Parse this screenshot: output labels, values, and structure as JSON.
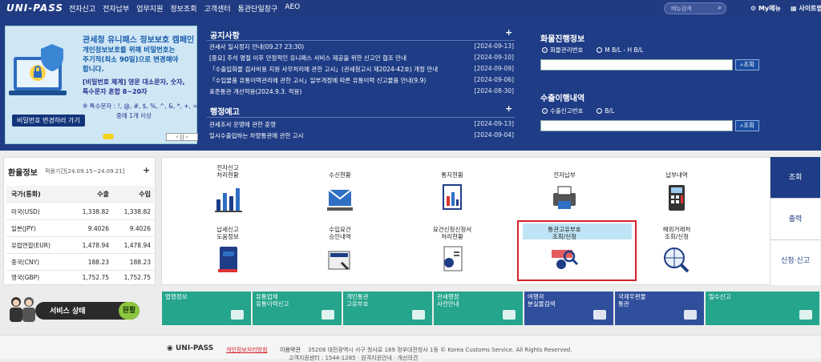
{
  "header": {
    "logo": "UNI-PASS",
    "nav": [
      "전자신고",
      "전자납부",
      "업무지원",
      "정보조회",
      "고객센터",
      "통관단일창구",
      "AEO"
    ],
    "search_placeholder": "메뉴검색",
    "mymenu": "My메뉴",
    "sitemap": "사이트맵"
  },
  "banner": {
    "title": "관세청 유니패스 정보보호 캠페인",
    "lines": [
      "개인정보보호를 위해 비밀번호는",
      "주기적(최소 90일)으로 변경해야",
      "합니다."
    ],
    "rules": [
      "[비밀번호 체계] 영문 대소문자, 숫자,",
      "특수문자 혼합 8~20자"
    ],
    "special": [
      "※ 특수문자 : !, @, #, $, %, ^, &, *, +, =, _",
      "중에 1개 이상"
    ],
    "button": "비밀번호 변경하러 가기",
    "controls": "‹  ||  ›"
  },
  "notice": {
    "title": "공지사항",
    "items": [
      {
        "text": "관세사 일시정지 안내(09.27 23:30)",
        "date": "[2024-09-13]"
      },
      {
        "text": "[중요] 추석 명절 이후 안정적인 유니패스 서비스 제공을 위한 신고인 협조 안내",
        "date": "[2024-09-10]"
      },
      {
        "text": "「수출입화물 검사비용 지원 사무처리에 관한 고시」(관세청고시 제2024-42호) 개정 안내",
        "date": "[2024-09-09]"
      },
      {
        "text": "「수입물품 유통이력관리에 관한 고시」일부개정에 따른 유통이력 신고물품 안내(9.9)",
        "date": "[2024-09-06]"
      },
      {
        "text": "표준통관 개선적용(2024.9.3. 적용)",
        "date": "[2024-08-30]"
      }
    ]
  },
  "admin_notice": {
    "title": "행정예고",
    "items": [
      {
        "text": "관세조사 운영에 관한 훈령",
        "date": "[2024-09-13]"
      },
      {
        "text": "일시수출입하는 차량통관에 관한 고시",
        "date": "[2024-09-04]"
      }
    ]
  },
  "cargo": {
    "title": "화물진행정보",
    "options": [
      "화물관리번호",
      "M B/L - H B/L"
    ],
    "button": "조회"
  },
  "export": {
    "title": "수출이행내역",
    "options": [
      "수출신고번호",
      "B/L"
    ],
    "button": "조회"
  },
  "fx": {
    "title": "환율정보",
    "period": "적용기간[24.09.15~24.09.21]",
    "headers": [
      "국가(통화)",
      "수출",
      "수입"
    ],
    "rows": [
      [
        "미국(USD)",
        "1,338.82",
        "1,338.82"
      ],
      [
        "일본(JPY)",
        "9.4026",
        "9.4026"
      ],
      [
        "유럽연합(EUR)",
        "1,478.94",
        "1,478.94"
      ],
      [
        "중국(CNY)",
        "188.23",
        "188.23"
      ],
      [
        "영국(GBP)",
        "1,752.75",
        "1,752.75"
      ]
    ]
  },
  "status": {
    "label": "서비스 상태",
    "value": "원활"
  },
  "services": [
    {
      "label": "전자신고\n처리현황",
      "icon": "chart-icon"
    },
    {
      "label": "수신현황",
      "icon": "mail-icon"
    },
    {
      "label": "통지현황",
      "icon": "report-icon"
    },
    {
      "label": "전자납부",
      "icon": "payment-icon"
    },
    {
      "label": "납부내역",
      "icon": "calculator-icon"
    },
    {
      "label": "납세신고\n도움정보",
      "icon": "book-icon"
    },
    {
      "label": "수입요건\n승인내역",
      "icon": "import-icon"
    },
    {
      "label": "요건신청신청서\n처리현황",
      "icon": "document-icon"
    },
    {
      "label": "통관고유부호\n조회/신청",
      "icon": "id-search-icon"
    },
    {
      "label": "해외거래처\n조회/신청",
      "icon": "globe-search-icon"
    }
  ],
  "tabs": [
    "조회",
    "출력",
    "신청·신고"
  ],
  "tiles": [
    "법령정보",
    "유통업체\n유통이력신고",
    "개인통관\n고유부호",
    "관세행정\n사전안내",
    "여행자\n분실물검색",
    "국제우편물\n통관",
    "밀수신고"
  ],
  "footer": {
    "brand": "UNI-PASS",
    "privacy": "개인정보처리방침",
    "terms": "이용약관",
    "address": "35208 대전광역시 서구 청사로 189 정부대전청사 1동 © Korea Customs Service. All Rights Reserved.",
    "address2": "고객지원센터 : 1544-1285 · 원격지원안내 · 개선의견"
  },
  "colors": {
    "primary": "#1f3d86",
    "teal": "#24a58c",
    "highlight": "#d4232b",
    "ok": "#8cc63f"
  }
}
